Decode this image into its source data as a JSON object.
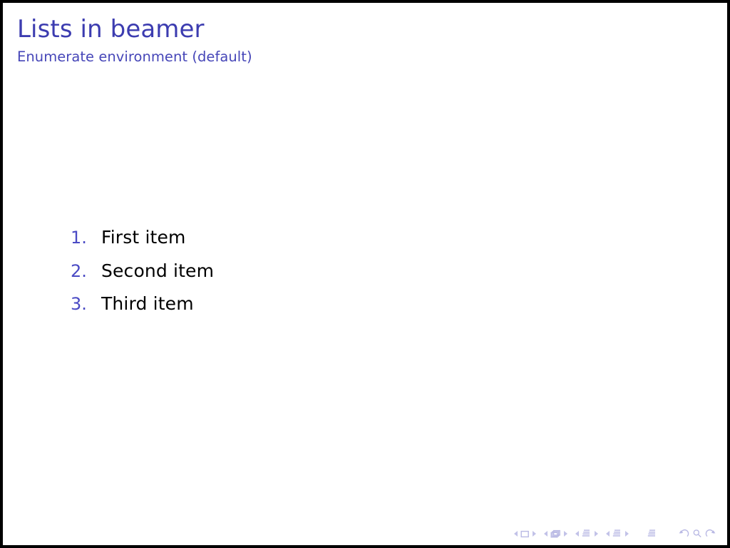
{
  "slide": {
    "title": "Lists in beamer",
    "subtitle": "Enumerate environment (default)",
    "background_color": "#ffffff",
    "frame_border_color": "#000000",
    "title_color": "#3c3cb0",
    "subtitle_color": "#4646b8",
    "marker_color": "#4a4ac4",
    "body_text_color": "#000000"
  },
  "list": {
    "type": "enumerate",
    "items": [
      {
        "marker": "1.",
        "text": "First item"
      },
      {
        "marker": "2.",
        "text": "Second item"
      },
      {
        "marker": "3.",
        "text": "Third item"
      }
    ]
  },
  "navigation": {
    "color": "#b9b9e4",
    "groups": [
      {
        "name": "slide",
        "icon": "slide-icon",
        "prev_label": "previous-slide",
        "next_label": "next-slide"
      },
      {
        "name": "frame",
        "icon": "frame-icon",
        "prev_label": "previous-frame",
        "next_label": "next-frame"
      },
      {
        "name": "subsection",
        "icon": "subsection-icon",
        "prev_label": "previous-subsection",
        "next_label": "next-subsection"
      },
      {
        "name": "section",
        "icon": "section-icon",
        "prev_label": "previous-section",
        "next_label": "next-section"
      }
    ],
    "presentation": {
      "icon": "presentation-icon",
      "label": "presentation"
    },
    "extras": [
      {
        "icon": "back-arrow-icon",
        "label": "go-back"
      },
      {
        "icon": "search-icon",
        "label": "search"
      },
      {
        "icon": "forward-arrow-icon",
        "label": "go-forward"
      }
    ]
  }
}
